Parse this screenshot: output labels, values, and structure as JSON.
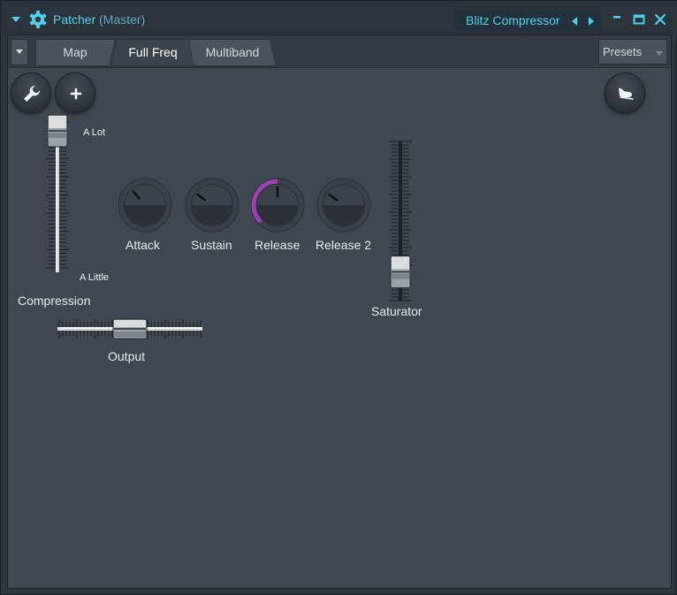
{
  "window": {
    "title": "Patcher",
    "title_suffix": "(Master)",
    "preset_name": "Blitz Compressor",
    "accent_color": "#4ed0ee"
  },
  "titlebar_icons": {
    "menu": "chevron-down-icon",
    "plugin": "gear-icon",
    "prev": "triangle-left-icon",
    "next": "triangle-right-icon",
    "minimize": "minimize-icon",
    "maximize": "maximize-icon",
    "close": "close-icon"
  },
  "tabs": [
    {
      "label": "Map",
      "active": false
    },
    {
      "label": "Full Freq",
      "active": true
    },
    {
      "label": "Multiband",
      "active": false
    }
  ],
  "presets": {
    "label": "Presets"
  },
  "tool_buttons": {
    "wrench": "wrench-icon",
    "add": "plus-icon",
    "hand": "hand-icon"
  },
  "compression": {
    "label": "Compression",
    "top_label": "A Lot",
    "bottom_label": "A Little",
    "level": 1.0
  },
  "output": {
    "label": "Output",
    "level": 0.5
  },
  "saturator": {
    "label": "Saturator",
    "level": 0.12
  },
  "knobs": [
    {
      "label": "Attack",
      "value": 0.35,
      "accent_color": null
    },
    {
      "label": "Sustain",
      "value": 0.3,
      "accent_color": null
    },
    {
      "label": "Release",
      "value": 0.5,
      "accent_color": "#9b3fb5"
    },
    {
      "label": "Release 2",
      "value": 0.3,
      "accent_color": null
    }
  ]
}
